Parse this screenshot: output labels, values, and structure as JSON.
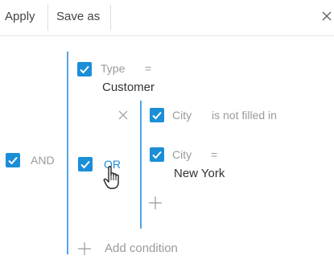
{
  "toolbar": {
    "apply_label": "Apply",
    "save_as_label": "Save as"
  },
  "root_group": {
    "operator": "AND",
    "checked": true
  },
  "conditions": {
    "type": {
      "field": "Type",
      "operator": "=",
      "value": "Customer",
      "checked": true
    },
    "or_group": {
      "operator": "OR",
      "checked": true,
      "city_not_filled": {
        "field": "City",
        "operator": "is not filled in",
        "checked": true
      },
      "city_equals": {
        "field": "City",
        "operator": "=",
        "value": "New York",
        "checked": true
      }
    }
  },
  "add_condition_label": "Add condition",
  "colors": {
    "accent": "#1b8ed8",
    "group_line": "#54a5e8",
    "muted_text": "#9a9a9a"
  }
}
